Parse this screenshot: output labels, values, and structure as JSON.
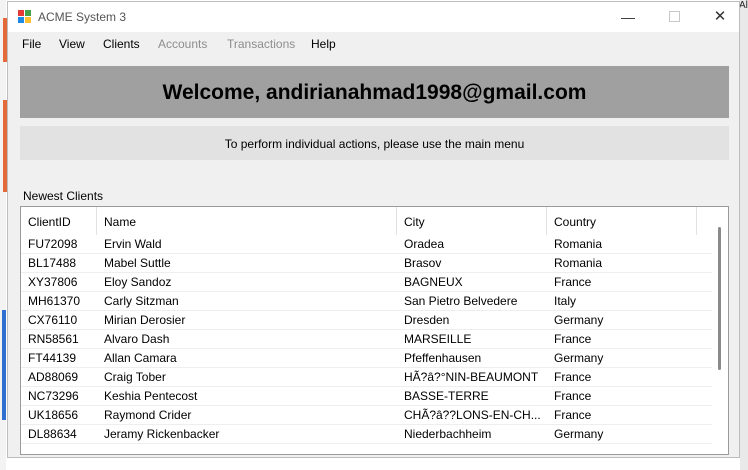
{
  "window": {
    "title": "ACME System 3"
  },
  "desktop": {
    "right_edge_text": "Al"
  },
  "menu": [
    {
      "label": "File",
      "enabled": true
    },
    {
      "label": "View",
      "enabled": true
    },
    {
      "label": "Clients",
      "enabled": true
    },
    {
      "label": "Accounts",
      "enabled": false
    },
    {
      "label": "Transactions",
      "enabled": false
    },
    {
      "label": "Help",
      "enabled": true
    }
  ],
  "welcome": {
    "text": "Welcome, andirianahmad1998@gmail.com"
  },
  "info": {
    "text": "To perform individual actions, please use the main menu"
  },
  "section": {
    "label": "Newest Clients"
  },
  "table": {
    "columns": [
      "ClientID",
      "Name",
      "City",
      "Country"
    ],
    "rows": [
      [
        "FU72098",
        "Ervin Wald",
        "Oradea",
        "Romania"
      ],
      [
        "BL17488",
        "Mabel Suttle",
        "Brasov",
        "Romania"
      ],
      [
        "XY37806",
        "Eloy Sandoz",
        "BAGNEUX",
        "France"
      ],
      [
        "MH61370",
        "Carly Sitzman",
        "San Pietro Belvedere",
        "Italy"
      ],
      [
        "CX76110",
        "Mirian Derosier",
        "Dresden",
        "Germany"
      ],
      [
        "RN58561",
        "Alvaro Dash",
        "MARSEILLE",
        "France"
      ],
      [
        "FT44139",
        "Allan Camara",
        "Pfeffenhausen",
        "Germany"
      ],
      [
        "AD88069",
        "Craig Tober",
        "HÃ?â?°NIN-BEAUMONT",
        "France"
      ],
      [
        "NC73296",
        "Keshia Pentecost",
        "BASSE-TERRE",
        "France"
      ],
      [
        "UK18656",
        "Raymond Crider",
        "CHÃ?â??LONS-EN-CH...",
        "France"
      ],
      [
        "DL88634",
        "Jeramy Rickenbacker",
        "Niederbachheim",
        "Germany"
      ]
    ]
  },
  "colors": {
    "welcome_bg": "#a0a0a0",
    "info_bg": "#e2e2e2",
    "window_bg": "#f0f0f0",
    "disabled_text": "#8d8d8d"
  }
}
